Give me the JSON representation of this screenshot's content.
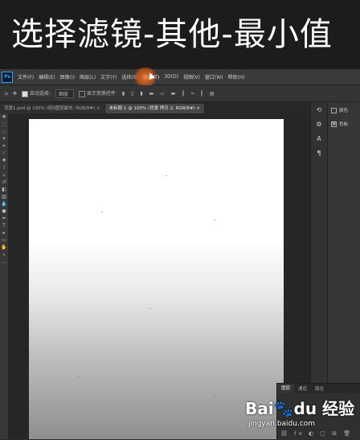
{
  "banner": {
    "title": "选择滤镜-其他-最小值"
  },
  "menubar": {
    "logo": "Ps",
    "items": [
      "文件(F)",
      "编辑(E)",
      "图像(I)",
      "图层(L)",
      "文字(Y)",
      "选择(S)",
      "滤镜(T)",
      "3D(D)",
      "视图(V)",
      "窗口(W)",
      "帮助(H)"
    ]
  },
  "optionsbar": {
    "move_icon": "move-icon",
    "auto_select_label": "自动选择:",
    "auto_select_value": "图层",
    "show_transform_label": "显示变换控件"
  },
  "tabs": [
    {
      "label": "背景1.psd @ 100% (组9图层副本, RGB/8#) ×"
    },
    {
      "label": "未标题-1 @ 100% (背景 拷贝 2, RGB/8#) ×"
    }
  ],
  "panel": {
    "items": [
      {
        "label": "颜色"
      },
      {
        "label": "色板"
      }
    ]
  },
  "bottom_panel": {
    "tabs": [
      "图层",
      "通道",
      "路径"
    ]
  },
  "watermark": {
    "logo": "Bai",
    "logo_mid": "du",
    "logo_suffix": "经验",
    "url": "jingyan.baidu.com"
  },
  "colors": {
    "accent_highlight": "#e8701e",
    "background": "#2b2b2b",
    "ps_blue": "#2fa3f6"
  }
}
